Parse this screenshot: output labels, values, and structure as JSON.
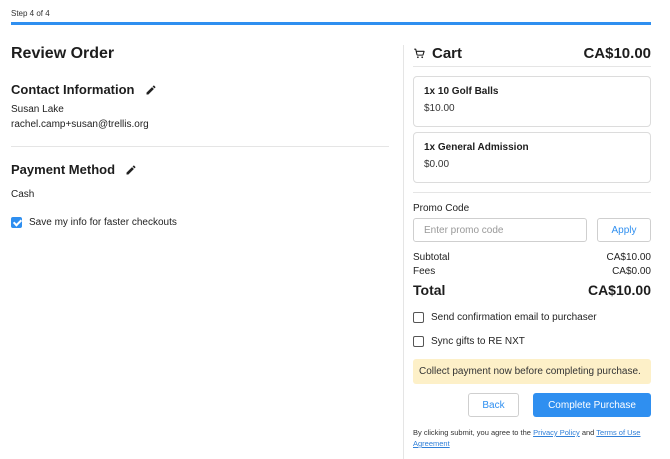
{
  "header": {
    "step_label": "Step 4 of 4",
    "progress_fraction": 1.0,
    "accent_color": "#2f8ff0"
  },
  "review": {
    "title": "Review Order",
    "contact": {
      "title": "Contact Information",
      "edit_icon": "pencil-icon",
      "name": "Susan Lake",
      "email": "rachel.camp+susan@trellis.org"
    },
    "payment": {
      "title": "Payment Method",
      "edit_icon": "pencil-icon",
      "method": "Cash"
    },
    "save_info": {
      "label": "Save my info for faster checkouts",
      "checked": true
    }
  },
  "cart": {
    "icon": "cart-icon",
    "title": "Cart",
    "total": "CA$10.00",
    "items": [
      {
        "name": "1x 10 Golf Balls",
        "price": "$10.00"
      },
      {
        "name": "1x General Admission",
        "price": "$0.00"
      }
    ],
    "promo": {
      "label": "Promo Code",
      "placeholder": "Enter promo code",
      "apply_label": "Apply"
    },
    "summary": {
      "subtotal_label": "Subtotal",
      "subtotal_value": "CA$10.00",
      "fees_label": "Fees",
      "fees_value": "CA$0.00",
      "total_label": "Total",
      "total_value": "CA$10.00"
    },
    "options": [
      {
        "label": "Send confirmation email to purchaser",
        "checked": false
      },
      {
        "label": "Sync gifts to RE NXT",
        "checked": false
      }
    ],
    "notice": "Collect payment now before completing purchase.",
    "notice_color": "#fdf0c8",
    "back_label": "Back",
    "complete_label": "Complete Purchase",
    "terms": {
      "prefix": "By clicking submit, you agree to the ",
      "privacy": "Privacy Policy",
      "and": " and ",
      "terms_link": "Terms of Use Agreement"
    }
  }
}
